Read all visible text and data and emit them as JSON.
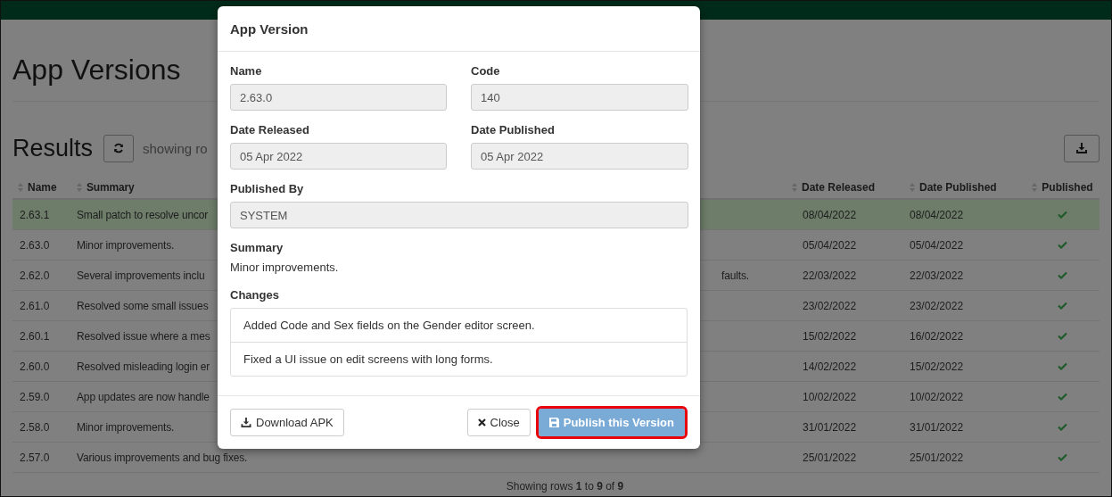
{
  "page": {
    "title": "App Versions",
    "results_heading": "Results",
    "showing_text": "showing ro",
    "footer": "Showing rows **1** to **9** of **9**"
  },
  "table": {
    "columns": [
      {
        "label": "Name"
      },
      {
        "label": "Summary"
      },
      {
        "label": "Date Released"
      },
      {
        "label": "Date Published"
      },
      {
        "label": "Published"
      }
    ],
    "rows": [
      {
        "name": "2.63.1",
        "summary": "Small patch to resolve uncor",
        "date_released": "08/04/2022",
        "date_published": "08/04/2022",
        "published": true,
        "selected": true
      },
      {
        "name": "2.63.0",
        "summary": "Minor improvements.",
        "date_released": "05/04/2022",
        "date_published": "05/04/2022",
        "published": true,
        "selected": false
      },
      {
        "name": "2.62.0",
        "summary": "Several improvements inclu",
        "summary_tail": "faults.",
        "date_released": "22/03/2022",
        "date_published": "22/03/2022",
        "published": true,
        "selected": false
      },
      {
        "name": "2.61.0",
        "summary": "Resolved some small issues",
        "date_released": "23/02/2022",
        "date_published": "23/02/2022",
        "published": true,
        "selected": false
      },
      {
        "name": "2.60.1",
        "summary": "Resolved issue where a mes",
        "date_released": "15/02/2022",
        "date_published": "16/02/2022",
        "published": true,
        "selected": false
      },
      {
        "name": "2.60.0",
        "summary": "Resolved misleading login er",
        "date_released": "14/02/2022",
        "date_published": "15/02/2022",
        "published": true,
        "selected": false
      },
      {
        "name": "2.59.0",
        "summary": "App updates are now handle",
        "date_released": "10/02/2022",
        "date_published": "10/02/2022",
        "published": true,
        "selected": false
      },
      {
        "name": "2.58.0",
        "summary": "Minor improvements.",
        "date_released": "31/01/2022",
        "date_published": "31/01/2022",
        "published": true,
        "selected": false
      },
      {
        "name": "2.57.0",
        "summary": "Various improvements and bug fixes.",
        "date_released": "25/01/2022",
        "date_published": "25/01/2022",
        "published": true,
        "selected": false
      }
    ]
  },
  "modal": {
    "title": "App Version",
    "fields": [
      {
        "label": "Name",
        "value": "2.63.0"
      },
      {
        "label": "Code",
        "value": "140"
      },
      {
        "label": "Date Released",
        "value": "05 Apr 2022"
      },
      {
        "label": "Date Published",
        "value": "05 Apr 2022"
      },
      {
        "label": "Published By",
        "value": "SYSTEM"
      }
    ],
    "summary_label": "Summary",
    "summary": "Minor improvements.",
    "changes_label": "Changes",
    "changes": [
      "Added Code and Sex fields on the Gender editor screen.",
      "Fixed a UI issue on edit screens with long forms."
    ],
    "buttons": {
      "download": "Download APK",
      "close": "Close",
      "publish": "Publish this Version"
    }
  }
}
